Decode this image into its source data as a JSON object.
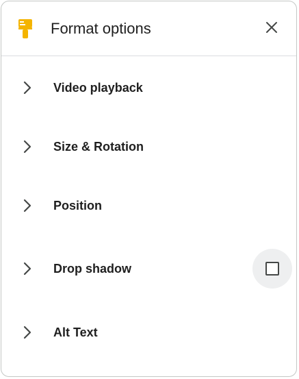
{
  "header": {
    "title": "Format options",
    "icon": "paint-roller-icon",
    "icon_color": "#f4b400",
    "close_icon": "close-icon"
  },
  "sections": [
    {
      "label": "Video playback",
      "icon": "chevron-right-icon"
    },
    {
      "label": "Size & Rotation",
      "icon": "chevron-right-icon"
    },
    {
      "label": "Position",
      "icon": "chevron-right-icon"
    },
    {
      "label": "Drop shadow",
      "icon": "chevron-right-icon",
      "checkbox": {
        "checked": false
      }
    },
    {
      "label": "Alt Text",
      "icon": "chevron-right-icon"
    }
  ],
  "colors": {
    "text": "#1f1f1f",
    "border": "#c4c7c5",
    "divider": "#dadce0",
    "accent": "#f4b400"
  }
}
